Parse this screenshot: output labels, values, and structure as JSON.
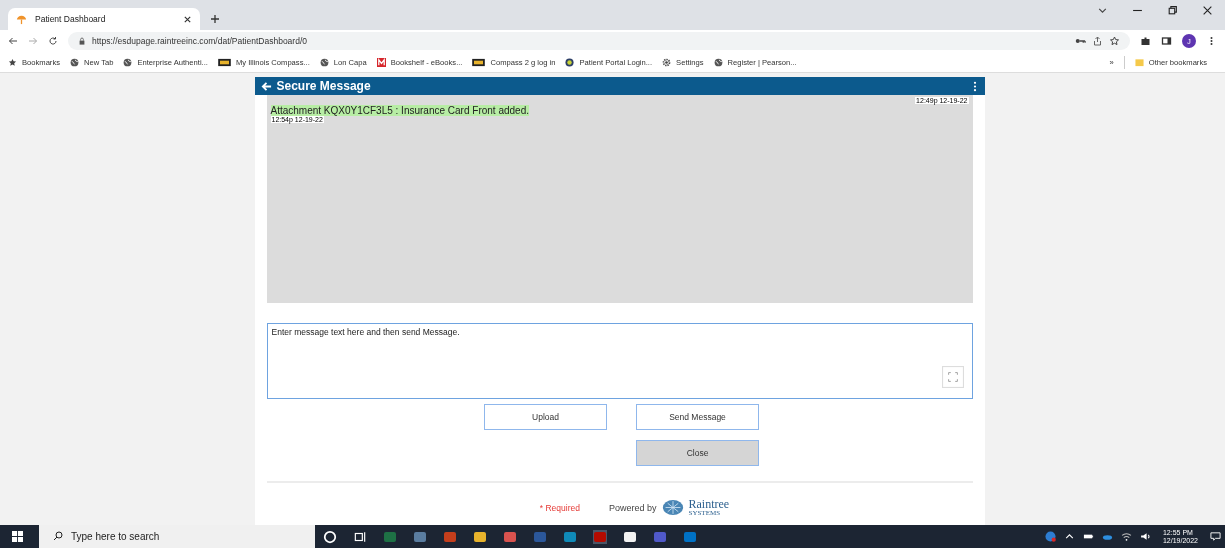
{
  "browser": {
    "tabs": [
      {
        "label": "Patient Dashboard",
        "selected": true
      }
    ],
    "url": "https://esdupage.raintreeinc.com/dat/PatientDashboard/0",
    "profile_initial": "J",
    "bookmarks": [
      {
        "kind": "star",
        "label": "Bookmarks"
      },
      {
        "kind": "globe",
        "label": "New Tab"
      },
      {
        "kind": "globe",
        "label": "Enterprise Authenti..."
      },
      {
        "kind": "bb",
        "label": "My Illinois Compass..."
      },
      {
        "kind": "globe",
        "label": "Lon Capa"
      },
      {
        "kind": "m",
        "label": "Bookshelf - eBooks..."
      },
      {
        "kind": "bb",
        "label": "Compass 2 g log in"
      },
      {
        "kind": "portal",
        "label": "Patient Portal Login..."
      },
      {
        "kind": "gear",
        "label": "Settings"
      },
      {
        "kind": "globe",
        "label": "Register | Pearson..."
      }
    ],
    "overflow": "»",
    "other_bookmarks": "Other bookmarks"
  },
  "dialog": {
    "title": "Secure Message",
    "messages": [
      {
        "kind": "time",
        "text": "12:49p 12-19-22"
      },
      {
        "kind": "attachment",
        "text": "Attachment KQX0Y1CF3L5 : Insurance Card Front added."
      },
      {
        "kind": "stamp",
        "text": "12:54p 12-19-22"
      }
    ],
    "compose": {
      "placeholder": "Enter message text here and then send Message."
    },
    "buttons": [
      {
        "kind": "plain",
        "label": "Upload"
      },
      {
        "kind": "plain",
        "label": "Send Message"
      },
      {
        "kind": "muted",
        "label": "Close"
      }
    ],
    "required": "* Required",
    "powered_by": "Powered by",
    "brand": "Raintree",
    "brand_sub": "SYSTEMS"
  },
  "taskbar": {
    "search_placeholder": "Type here to search",
    "time": "12:55 PM",
    "date": "12/19/2022"
  }
}
